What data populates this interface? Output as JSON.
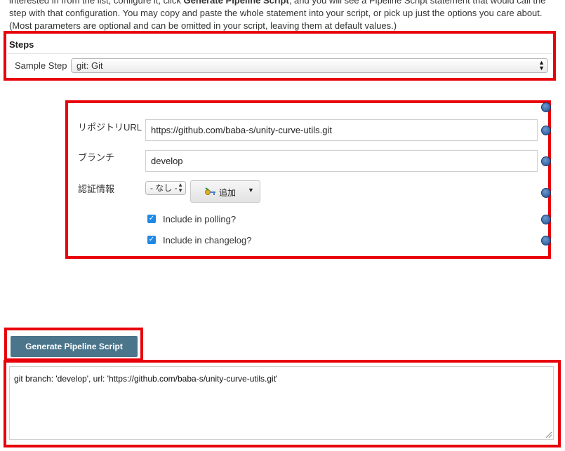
{
  "intro": {
    "line1_pre": "interested in from the list, configure it, click ",
    "line1_bold": "Generate Pipeline Script",
    "line1_post": ", and you will see a Pipeline Script statement that would call the",
    "line2": "step with that configuration. You may copy and paste the whole statement into your script, or pick up just the options you care about.",
    "line3": "(Most parameters are optional and can be omitted in your script, leaving them at default values.)"
  },
  "steps": {
    "heading": "Steps",
    "sample_label": "Sample Step",
    "sample_value": "git: Git"
  },
  "form": {
    "repo_label": "リポジトリURL",
    "repo_value": "https://github.com/baba-s/unity-curve-utils.git",
    "branch_label": "ブランチ",
    "branch_value": "develop",
    "cred_label": "認証情報",
    "cred_value": "- なし -",
    "add_label": "追加",
    "polling_label": "Include in polling?",
    "polling_checked": true,
    "changelog_label": "Include in changelog?",
    "changelog_checked": true
  },
  "generate_label": "Generate Pipeline Script",
  "output_text": "git branch: 'develop', url: 'https://github.com/baba-s/unity-curve-utils.git'",
  "colors": {
    "highlight_red": "#e8000b",
    "button_teal": "#4b758b",
    "checkbox_blue": "#1e88e5"
  }
}
